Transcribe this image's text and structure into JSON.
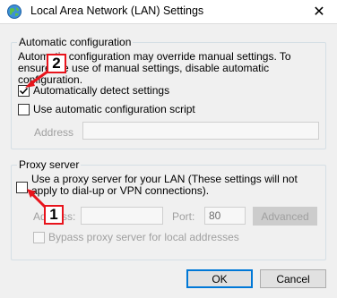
{
  "window": {
    "title": "Local Area Network (LAN) Settings",
    "icon": "globe-network-icon",
    "close_glyph": "✕"
  },
  "auto_config": {
    "legend": "Automatic configuration",
    "description": "Automatic configuration may override manual settings.  To ensure the use of manual settings, disable automatic configuration.",
    "detect_label": "Automatically detect settings",
    "detect_checked": true,
    "script_label": "Use automatic configuration script",
    "script_checked": false,
    "address_label": "Address",
    "address_value": ""
  },
  "proxy": {
    "legend": "Proxy server",
    "use_proxy_label": "Use a proxy server for your LAN (These settings will not apply to dial-up or VPN connections).",
    "use_proxy_checked": false,
    "address_label": "Address:",
    "address_value": "",
    "port_label": "Port:",
    "port_value": "80",
    "advanced_label": "Advanced",
    "bypass_label": "Bypass proxy server for local addresses",
    "bypass_checked": false
  },
  "buttons": {
    "ok_label": "OK",
    "cancel_label": "Cancel"
  },
  "annotations": {
    "step1": "1",
    "step2": "2",
    "color": "#e8141c"
  }
}
